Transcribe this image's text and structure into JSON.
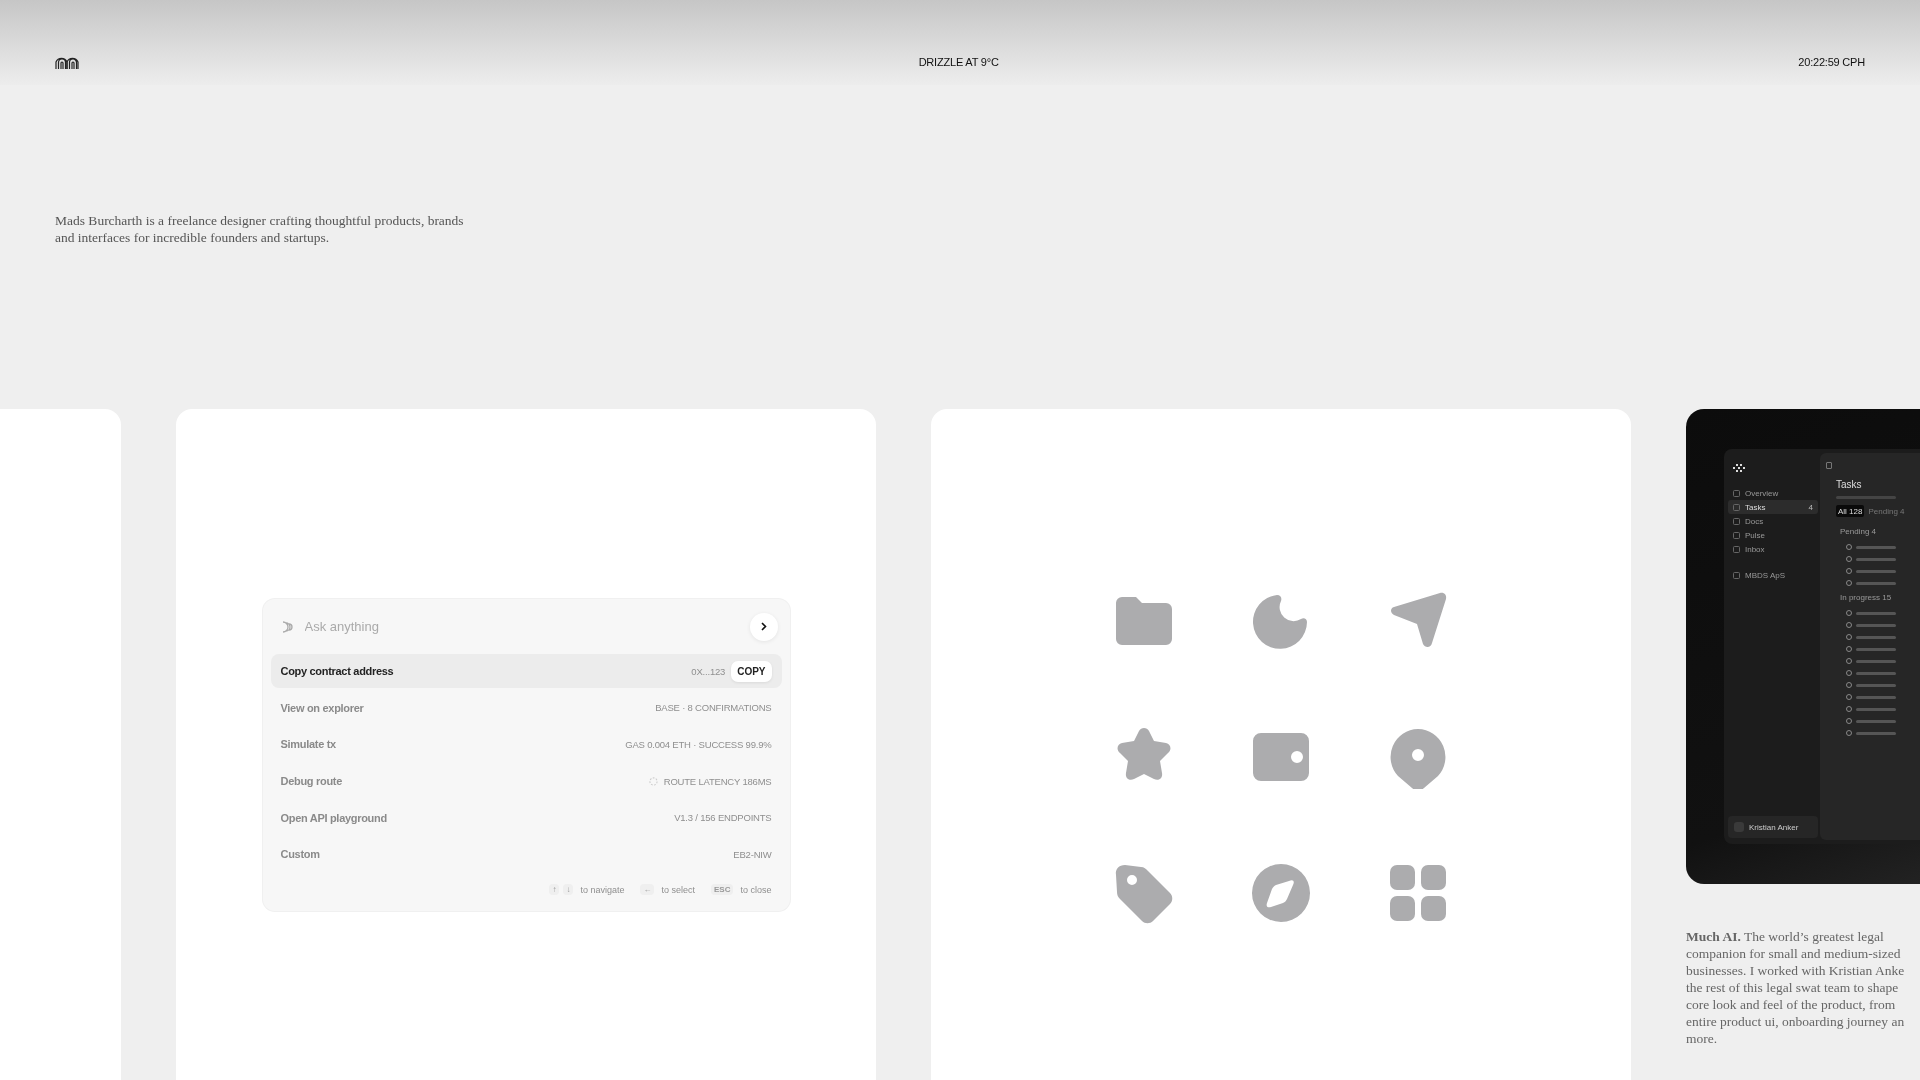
{
  "header": {
    "weather": "DRIZZLE AT 9°C",
    "clock": "20:22:59 CPH"
  },
  "intro": "Mads Burcharth is a freelance designer crafting thoughtful products, brands and interfaces for incredible founders and startups.",
  "palette": {
    "placeholder": "Ask anything",
    "items": [
      {
        "label": "Copy contract address",
        "detail": "0X...123",
        "action": "COPY",
        "selected": true,
        "loading": false
      },
      {
        "label": "View on explorer",
        "detail": "BASE · 8 CONFIRMATIONS",
        "selected": false,
        "loading": false
      },
      {
        "label": "Simulate tx",
        "detail": "GAS 0.004 ETH · SUCCESS 99.9%",
        "selected": false,
        "loading": false
      },
      {
        "label": "Debug route",
        "detail": "ROUTE LATENCY 186MS",
        "selected": false,
        "loading": true
      },
      {
        "label": "Open API playground",
        "detail": "V1.3 / 156 ENDPOINTS",
        "selected": false,
        "loading": false
      },
      {
        "label": "Custom",
        "detail": "EB2-NIW",
        "selected": false,
        "loading": false
      }
    ],
    "hints": [
      {
        "keys": [
          "↑",
          "↓"
        ],
        "label": "to navigate"
      },
      {
        "keys": [
          "←"
        ],
        "label": "to select"
      },
      {
        "keys": [
          "ESC"
        ],
        "label": "to close"
      }
    ]
  },
  "project": {
    "app": {
      "nav": [
        {
          "label": "Overview",
          "selected": false
        },
        {
          "label": "Tasks",
          "badge": "4",
          "selected": true
        },
        {
          "label": "Docs",
          "selected": false
        },
        {
          "label": "Pulse",
          "selected": false
        },
        {
          "label": "Inbox",
          "selected": false
        }
      ],
      "workspace": "MBDS ApS",
      "user": "Kristian Anker",
      "title": "Tasks",
      "filters": [
        {
          "label": "All",
          "count": "128",
          "selected": true
        },
        {
          "label": "Pending",
          "count": "4",
          "selected": false
        }
      ],
      "groups": [
        {
          "name": "Pending",
          "count": "4"
        },
        {
          "name": "In progress",
          "count": "15"
        }
      ]
    },
    "caption_lines": [
      "**Much AI.** The world’s greatest legal",
      "companion for small and medium-sized",
      "businesses. I worked with Kristian Anke",
      "the rest of this legal swat team to shape",
      "core look and feel of the product, from",
      "entire product ui, onboarding journey an",
      "more."
    ]
  }
}
